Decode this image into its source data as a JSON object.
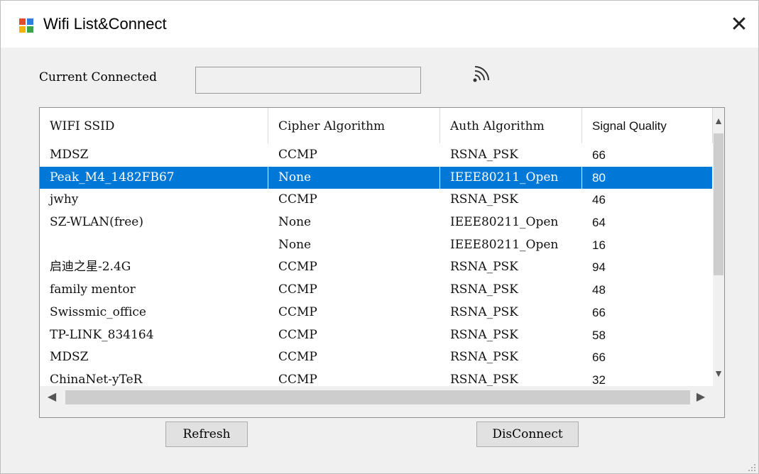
{
  "window": {
    "title": "Wifi List&Connect",
    "close_glyph": "✕"
  },
  "current": {
    "label": "Current Connected",
    "value": ""
  },
  "icons": {
    "app": "app-window-icon",
    "wifi": "wifi-signal-icon"
  },
  "table": {
    "headers": [
      "WIFI SSID",
      "Cipher Algorithm",
      "Auth Algorithm",
      "Signal Quality"
    ],
    "rows": [
      [
        "MDSZ",
        "CCMP",
        "RSNA_PSK",
        "66"
      ],
      [
        "Peak_M4_1482FB67",
        "None",
        "IEEE80211_Open",
        "80"
      ],
      [
        "jwhy",
        "CCMP",
        "RSNA_PSK",
        "46"
      ],
      [
        "SZ-WLAN(free)",
        "None",
        "IEEE80211_Open",
        "64"
      ],
      [
        "",
        "None",
        "IEEE80211_Open",
        "16"
      ],
      [
        "启迪之星-2.4G",
        "CCMP",
        "RSNA_PSK",
        "94"
      ],
      [
        "family mentor",
        "CCMP",
        "RSNA_PSK",
        "48"
      ],
      [
        "Swissmic_office",
        "CCMP",
        "RSNA_PSK",
        "66"
      ],
      [
        "TP-LINK_834164",
        "CCMP",
        "RSNA_PSK",
        "58"
      ],
      [
        "MDSZ",
        "CCMP",
        "RSNA_PSK",
        "66"
      ],
      [
        "ChinaNet-yTeR",
        "CCMP",
        "RSNA_PSK",
        "32"
      ]
    ],
    "selected_index": 1
  },
  "buttons": {
    "refresh": "Refresh",
    "disconnect": "DisConnect"
  },
  "colors": {
    "selection": "#0078d7"
  }
}
